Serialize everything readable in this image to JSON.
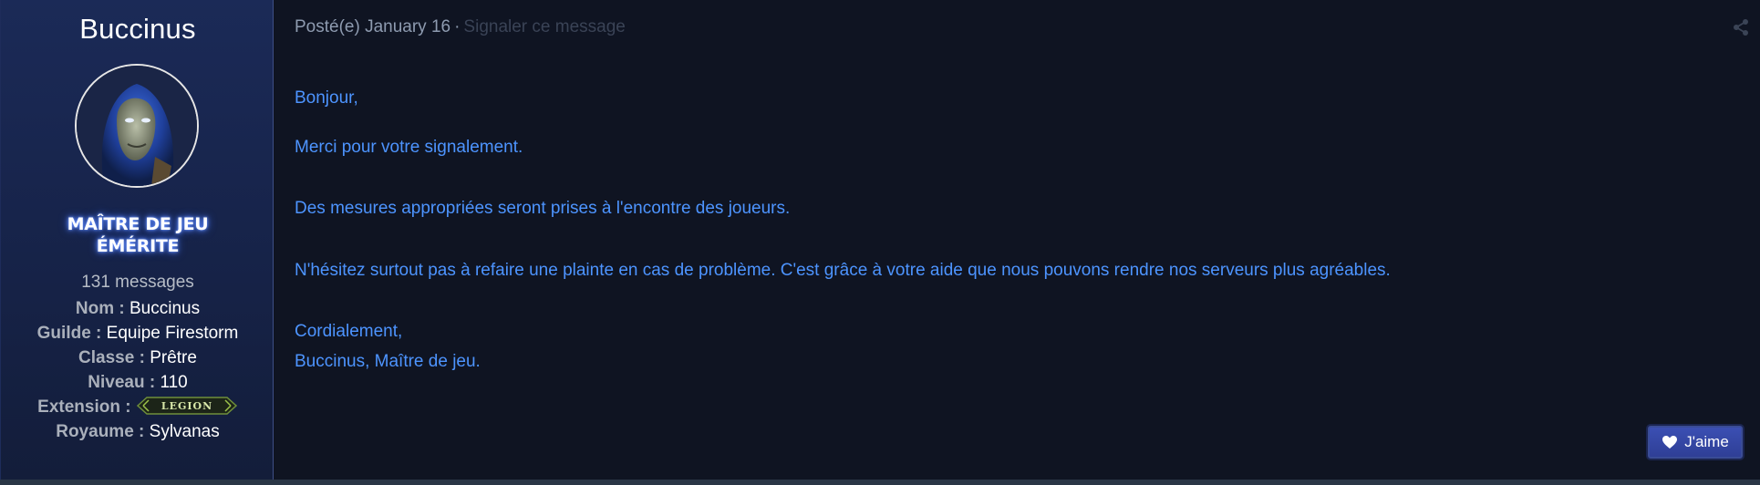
{
  "author": {
    "name": "Buccinus",
    "rank_line1": "MAÎTRE DE JEU",
    "rank_line2": "ÉMÉRITE",
    "message_count": "131 messages",
    "info": [
      {
        "label": "Nom :",
        "value": "Buccinus"
      },
      {
        "label": "Guilde :",
        "value": "Equipe Firestorm"
      },
      {
        "label": "Classe :",
        "value": "Prêtre"
      },
      {
        "label": "Niveau :",
        "value": "110"
      },
      {
        "label": "Extension :",
        "value": "LEGION"
      },
      {
        "label": "Royaume :",
        "value": "Sylvanas"
      }
    ]
  },
  "post": {
    "posted_label": "Posté(e) January 16",
    "separator": "·",
    "report_label": "Signaler ce message",
    "paragraphs": [
      "Bonjour,",
      "Merci pour votre signalement.",
      "Des mesures appropriées seront prises à l'encontre des joueurs.",
      "N'hésitez surtout pas à refaire une plainte en cas de problème. C'est grâce à votre aide que nous pouvons rendre nos serveurs plus agréables.",
      "Cordialement,",
      "Buccinus, Maître de jeu."
    ],
    "like_label": "J'aime"
  },
  "colors": {
    "page_bg": "#0f1422",
    "sidebar_bg": "#1b2a57",
    "content_text": "#4d94ff",
    "rank_glow": "#5f8bff",
    "like_button": "#3b4fb3"
  },
  "icons": {
    "share": "share-icon",
    "like": "heart-icon",
    "extension": "legion-logo"
  }
}
